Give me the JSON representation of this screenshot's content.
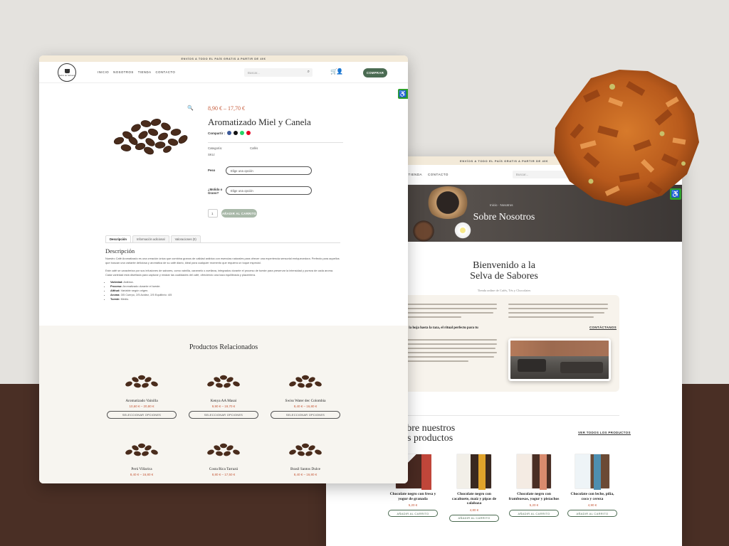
{
  "back_page": {
    "topbar": "ENVÍOS A TODO EL PAÍS GRATIS A PARTIR DE 40€",
    "nav": [
      "TIENDA",
      "CONTACTO"
    ],
    "nav_partial": "OS",
    "search_placeholder": "Buscar...",
    "breadcrumb": "Inicio  ·  Nosotros",
    "hero_title": "Sobre Nosotros",
    "welcome_line1": "Bienvenido a la",
    "welcome_line2": "Selva de Sabores",
    "tagline": "Tienda online de Cafés, Tés y Chocolates",
    "mission_partial": "de la hoja hasta la taza, el ritual perfecto para tu",
    "contact_link": "CONTÁCTANOS",
    "discover_line1": "cubre nuestros",
    "discover_line2": "nos productos",
    "view_all": "VER TODOS LOS PRODUCTOS",
    "products": [
      {
        "name": "Chocolate negro con fresa y yogur de granada",
        "price": "5,20 €",
        "button": "AÑADIR AL CARRITO",
        "color": "#c0463a"
      },
      {
        "name": "Chocolate negro con cacahuete, maíz y pipas de calabaza",
        "price": "4,80 €",
        "button": "AÑADIR AL CARRITO",
        "color": "#e0a32b"
      },
      {
        "name": "Chocolate negro con frambuesas, yogur y pistachos",
        "price": "5,20 €",
        "button": "AÑADIR AL CARRITO",
        "color": "#d98b6e"
      },
      {
        "name": "Chocolate con leche, piña, coco y cereza",
        "price": "4,90 €",
        "button": "AÑADIR AL CARRITO",
        "color": "#4e8fb0"
      }
    ]
  },
  "front_page": {
    "topbar": "ENVÍOS A TODO EL PAÍS GRATIS A PARTIR DE 40€",
    "logo_text": "Selva de Sabores",
    "nav": [
      "INICIO",
      "NOSOTROS",
      "TIENDA",
      "CONTACTO"
    ],
    "search_placeholder": "Buscar...",
    "cta_button": "COMPRAR",
    "product": {
      "price_range": "8,90 € – 17,70 €",
      "title": "Aromatizado Miel y Canela",
      "share_label": "Compartir :",
      "category_label": "Categoría:",
      "category_value": "Cafés",
      "sku_label": "SKU:",
      "option1_label": "Peso",
      "option2_label": "¿Molido o Grano?",
      "select_placeholder": "Elige una opción",
      "qty": "1",
      "add_button": "AÑADIR AL CARRITO"
    },
    "tabs": [
      "Descripción",
      "Información adicional",
      "Valoraciones (0)"
    ],
    "desc_title": "Descripción",
    "desc_p1": "Nuestro Café Aromatizado es una creación única que combina granos de calidad arábica con esencias naturales para ofrecer una experiencia sensorial enriquecedora. Perfecto para aquellos que buscan una variante deliciosa y aromática de su café diario, ideal para cualquier momento que requiera un toque especial.",
    "desc_p2": "Este café se caracteriza por sus infusiones de sabores, como vainilla, caramelo o avellana, integrados durante el proceso de tueste para preservar la intensidad y pureza de cada aroma. Cada variedad está diseñada para capturar y realzar las cualidades del café, ofreciendo una taza equilibrada y placentera.",
    "bullets": [
      {
        "k": "Variedad:",
        "v": " Arábica."
      },
      {
        "k": "Proceso:",
        "v": " Aromatizado durante el tueste."
      },
      {
        "k": "Altitud:",
        "v": " Variable según origen."
      },
      {
        "k": "Aroma:",
        "v": " 3/5 Cuerpo, 2/5 Acidez, 2/5 Equilibrio: 4/5"
      },
      {
        "k": "Tueste:",
        "v": " Medio."
      }
    ],
    "related_title": "Productos Relacionados",
    "related": [
      {
        "name": "Aromatizado Vainilla",
        "price": "10,60 € – 20,80 €",
        "button": "SELECCIONAR OPCIONES"
      },
      {
        "name": "Kenya AA Masai",
        "price": "9,90 € – 19,70 €",
        "button": "SELECCIONAR OPCIONES"
      },
      {
        "name": "Swiss Water deс Colombia",
        "price": "8,40 € – 16,80 €",
        "button": "SELECCIONAR OPCIONES"
      },
      {
        "name": "Perú Villarica",
        "price": "8,40 € – 16,80 €",
        "button": "SELECCIONAR OPCIONES"
      },
      {
        "name": "Costa Rica Tarrazú",
        "price": "8,80 € – 17,50 €",
        "button": "SELECCIONAR OPCIONES"
      },
      {
        "name": "Brasil Santos Dulce",
        "price": "8,40 € – 16,80 €",
        "button": "SELECCIONAR OPCIONES"
      }
    ]
  },
  "colors": {
    "accent_green": "#4a6b52",
    "price_orange": "#c65a3a",
    "accessibility_green": "#2da02d",
    "background_brown": "#4a2f25"
  }
}
